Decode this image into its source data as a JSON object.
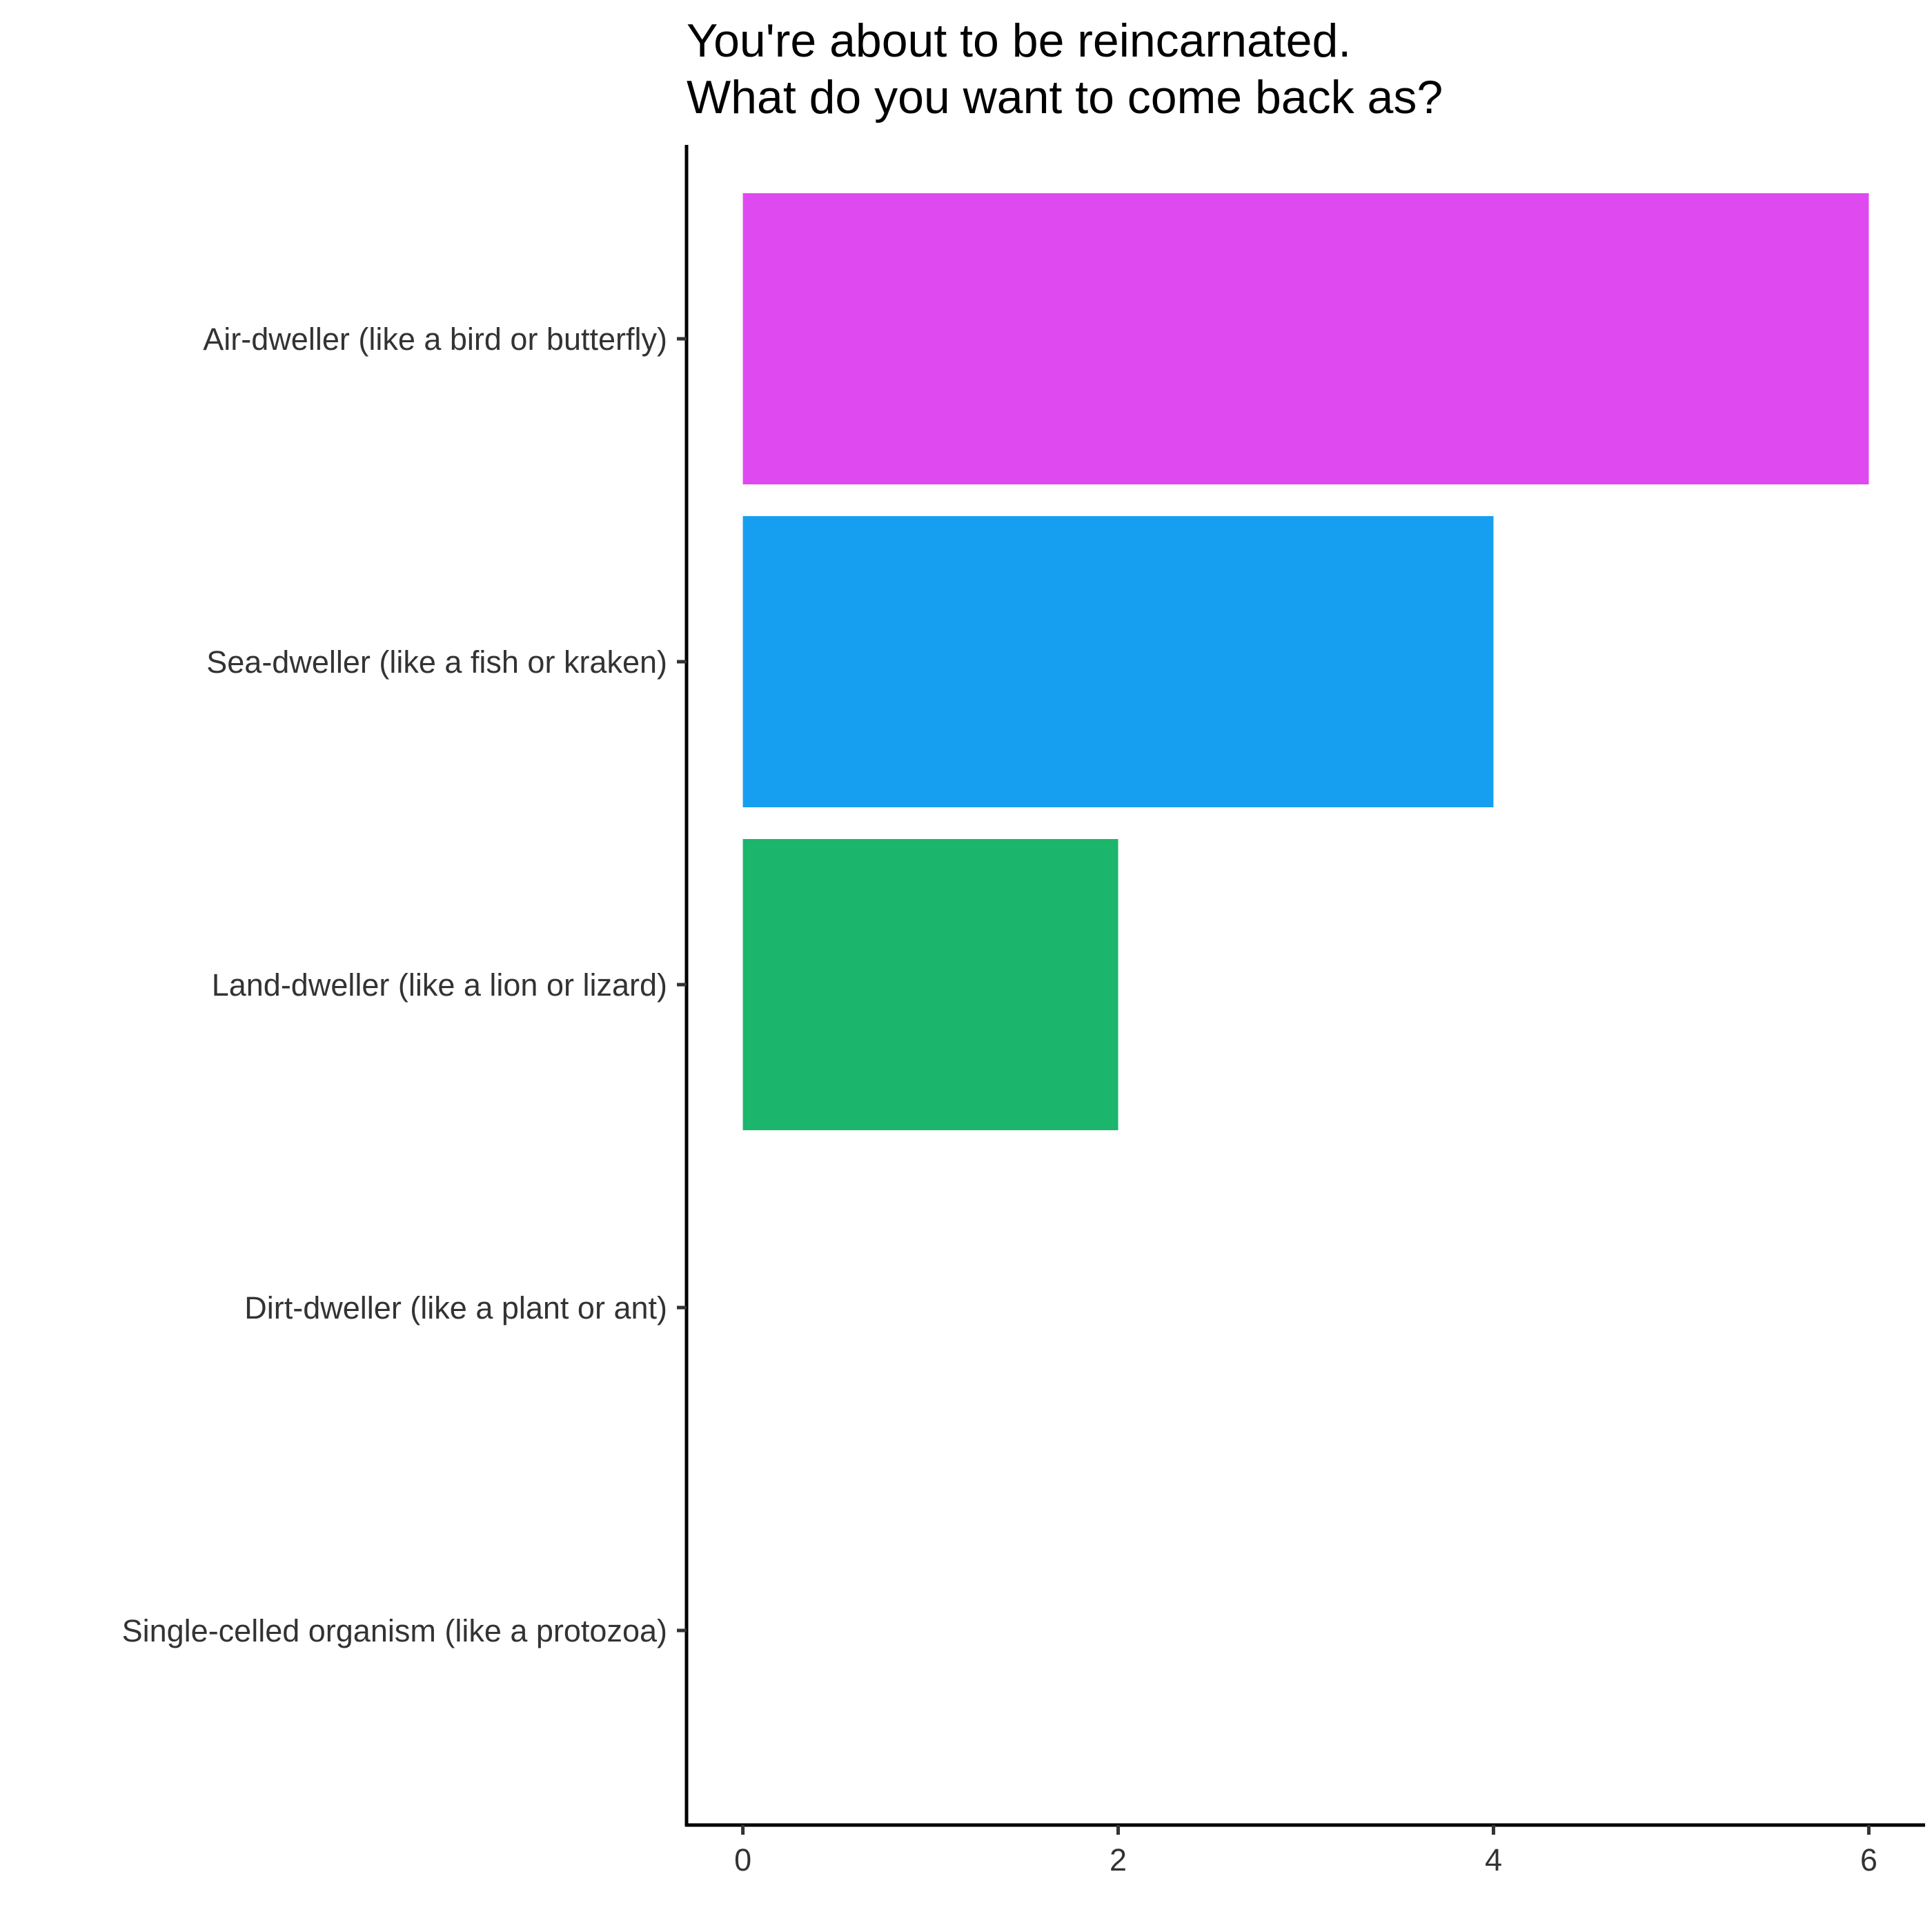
{
  "chart_data": {
    "type": "bar",
    "orientation": "horizontal",
    "title": "You're about to be reincarnated.\nWhat do you want to come back as?",
    "xlabel": "",
    "ylabel": "",
    "categories": [
      "Air-dweller (like a bird or butterfly)",
      "Sea-dweller (like a fish or kraken)",
      "Land-dweller (like a lion or lizard)",
      "Dirt-dweller (like a plant or ant)",
      "Single-celled organism (like a protozoa)"
    ],
    "values": [
      6,
      4,
      2,
      0,
      0
    ],
    "colors": [
      "#DF4AF0",
      "#169FF0",
      "#1BB56B",
      "#F0A11B",
      "#E8766B"
    ],
    "xlim": [
      -0.3,
      6.3
    ],
    "xticks": [
      0,
      2,
      4,
      6
    ],
    "grid": false,
    "legend": "none"
  }
}
